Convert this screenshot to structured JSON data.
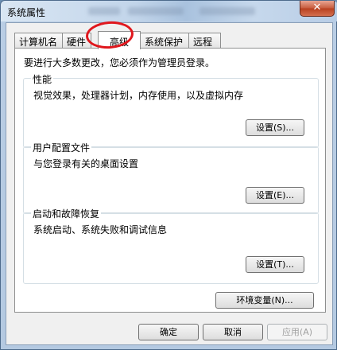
{
  "window": {
    "title": "系统属性",
    "close_glyph": "✕"
  },
  "tabs": [
    {
      "label": "计算机名"
    },
    {
      "label": "硬件"
    },
    {
      "label": "高级",
      "active": true
    },
    {
      "label": "系统保护"
    },
    {
      "label": "远程"
    }
  ],
  "notice": "要进行大多数更改，您必须作为管理员登录。",
  "groups": {
    "performance": {
      "title": "性能",
      "desc": "视觉效果，处理器计划，内存使用，以及虚拟内存",
      "button": "设置(S)..."
    },
    "profiles": {
      "title": "用户配置文件",
      "desc": "与您登录有关的桌面设置",
      "button": "设置(E)..."
    },
    "startup": {
      "title": "启动和故障恢复",
      "desc": "系统启动、系统失败和调试信息",
      "button": "设置(T)..."
    }
  },
  "env_button": "环境变量(N)...",
  "footer": {
    "ok": "确定",
    "cancel": "取消",
    "apply": "应用(A)"
  },
  "colors": {
    "highlight_circle": "#e0171d",
    "close_button": "#c75a3c"
  }
}
